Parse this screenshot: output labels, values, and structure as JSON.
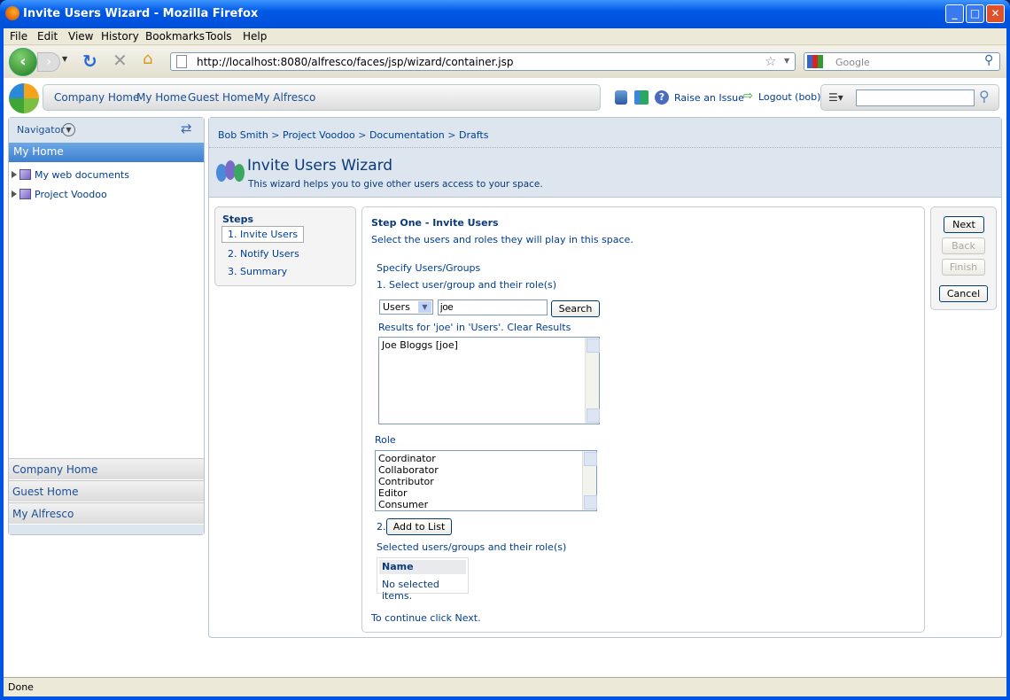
{
  "window": {
    "title": "Invite Users Wizard - Mozilla Firefox"
  },
  "menu": [
    "File",
    "Edit",
    "View",
    "History",
    "Bookmarks",
    "Tools",
    "Help"
  ],
  "toolbar": {
    "url": "http://localhost:8080/alfresco/faces/jsp/wizard/container.jsp",
    "search_placeholder": "Google"
  },
  "header": {
    "nav": [
      "Company Home",
      "My Home",
      "Guest Home",
      "My Alfresco"
    ],
    "raise_issue": "Raise an Issue",
    "logout": "Logout (bob)",
    "search_value": ""
  },
  "sidebar": {
    "title": "Navigator",
    "selected": "My Home",
    "tree": [
      "My web documents",
      "Project Voodoo"
    ],
    "bottom": [
      "Company Home",
      "Guest Home",
      "My Alfresco"
    ]
  },
  "breadcrumb": [
    "Bob Smith",
    "Project Voodoo",
    "Documentation",
    "Drafts"
  ],
  "wizard": {
    "title": "Invite Users Wizard",
    "description": "This wizard helps you to give other users access to your space."
  },
  "steps": {
    "title": "Steps",
    "items": [
      "1. Invite Users",
      "2. Notify Users",
      "3. Summary"
    ]
  },
  "content": {
    "heading": "Step One - Invite Users",
    "intro": "Select the users and roles they will play in this space.",
    "specify": "Specify Users/Groups",
    "step1": "1. Select user/group and their role(s)",
    "type_select": "Users",
    "search_value": "joe",
    "search_button": "Search",
    "results_label": "Results for 'joe' in 'Users'. ",
    "clear_results": "Clear Results",
    "results": [
      "Joe Bloggs [joe]"
    ],
    "role_label": "Role",
    "roles": [
      "Coordinator",
      "Collaborator",
      "Contributor",
      "Editor",
      "Consumer"
    ],
    "step2": "2.",
    "add_button": "Add to List",
    "selected_label": "Selected users/groups and their role(s)",
    "table_header": "Name",
    "table_empty": "No selected items.",
    "continue": "To continue click Next."
  },
  "buttons": {
    "next": "Next",
    "back": "Back",
    "finish": "Finish",
    "cancel": "Cancel"
  },
  "status": "Done"
}
